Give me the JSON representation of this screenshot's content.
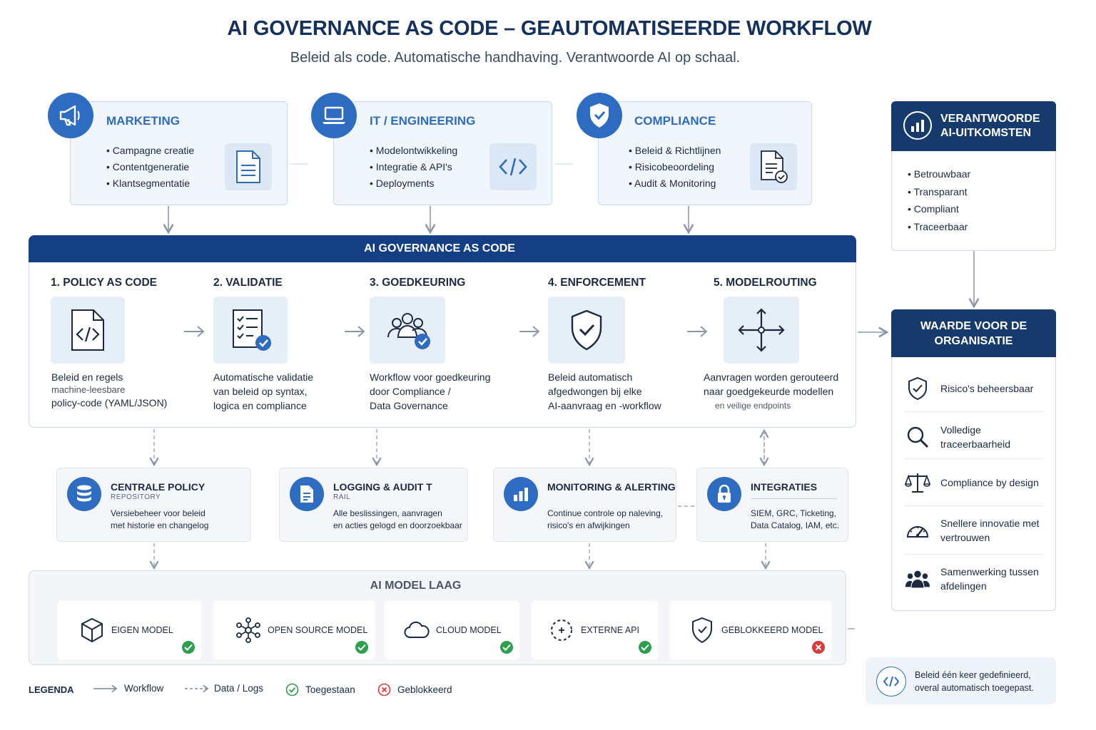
{
  "header": {
    "title": "AI GOVERNANCE AS CODE – GEAUTOMATISEERDE WORKFLOW",
    "subtitle": "Beleid als code. Automatische handhaving. Verantwoorde AI op schaal."
  },
  "departments": [
    {
      "title": "MARKETING",
      "icon": "megaphone-icon",
      "doc_icon": "document-icon",
      "items": [
        "Campagne creatie",
        "Contentgeneratie",
        "Klantsegmentatie"
      ]
    },
    {
      "title": "IT / ENGINEERING",
      "icon": "laptop-icon",
      "doc_icon": "code-icon",
      "items": [
        "Modelontwikkeling",
        "Integratie & API's",
        "Deployments"
      ]
    },
    {
      "title": "COMPLIANCE",
      "icon": "shield-check-icon",
      "doc_icon": "document-check-icon",
      "items": [
        "Beleid & Richtlijnen",
        "Risicobeoordeling",
        "Audit & Monitoring"
      ]
    }
  ],
  "governance": {
    "title": "AI GOVERNANCE AS CODE",
    "steps": [
      {
        "title": "1. POLICY AS CODE",
        "icon": "code-file-icon",
        "lines": [
          "Beleid en regels",
          "machine-leesbare",
          "policy-code (YAML/JSON)"
        ]
      },
      {
        "title": "2. VALIDATIE",
        "icon": "checklist-icon",
        "lines": [
          "Automatische validatie",
          "van beleid op syntax,",
          "logica en compliance"
        ]
      },
      {
        "title": "3. GOEDKEURING",
        "icon": "team-approval-icon",
        "lines": [
          "Workflow voor goedkeuring",
          "door Compliance /",
          "Data Governance"
        ]
      },
      {
        "title": "4. ENFORCEMENT",
        "icon": "shield-enforce-icon",
        "lines": [
          "Beleid automatisch",
          "afgedwongen bij elke",
          "AI-aanvraag en -workflow"
        ]
      },
      {
        "title": "5. MODELROUTING",
        "icon": "routing-icon",
        "lines": [
          "Aanvragen worden gerouteerd",
          "naar goedgekeurde modellen",
          "en veilige endpoints"
        ]
      }
    ]
  },
  "services": [
    {
      "title": "CENTRALE POLICY",
      "subtitle": "REPOSITORY",
      "icon": "database-icon",
      "lines": [
        "Versiebeheer voor beleid",
        "met historie en changelog"
      ]
    },
    {
      "title": "LOGGING & AUDIT T",
      "subtitle": "RAIL",
      "icon": "log-file-icon",
      "lines": [
        "Alle beslissingen, aanvragen",
        "en acties gelogd en doorzoekbaar"
      ]
    },
    {
      "title": "MONITORING & ALERTING",
      "subtitle": "",
      "icon": "bar-chart-icon",
      "lines": [
        "Continue controle op naleving,",
        "risico's en afwijkingen"
      ]
    },
    {
      "title": "INTEGRATIES",
      "subtitle": "",
      "icon": "lock-icon",
      "lines": [
        "SIEM, GRC, Ticketing,",
        "Data Catalog, IAM, etc."
      ]
    }
  ],
  "model_layer": {
    "title": "AI MODEL LAAG",
    "models": [
      {
        "label": "EIGEN MODEL",
        "icon": "cube-icon",
        "status": "allowed",
        "status_icon": "check-circle-icon"
      },
      {
        "label": "OPEN SOURCE MODEL",
        "icon": "network-icon",
        "status": "allowed",
        "status_icon": "check-circle-icon"
      },
      {
        "label": "CLOUD MODEL",
        "icon": "cloud-icon",
        "status": "allowed",
        "status_icon": "check-circle-icon"
      },
      {
        "label": "EXTERNE API",
        "icon": "dashed-circle-icon",
        "status": "allowed",
        "status_icon": "check-circle-icon"
      },
      {
        "label": "GEBLOKKEERD MODEL",
        "icon": "shield-blocked-icon",
        "status": "blocked",
        "status_icon": "x-circle-icon"
      }
    ]
  },
  "legend": {
    "title": "LEGENDA",
    "items": [
      {
        "label": "Workflow",
        "icon": "solid-arrow-icon"
      },
      {
        "label": "Data / Logs",
        "icon": "dashed-arrow-icon"
      },
      {
        "label": "Toegestaan",
        "icon": "check-circle-icon"
      },
      {
        "label": "Geblokkeerd",
        "icon": "x-circle-icon"
      }
    ]
  },
  "outcomes": {
    "title": "VERANTWOORDE AI-UITKOMSTEN",
    "icon": "bar-chart-icon",
    "items": [
      "Betrouwbaar",
      "Transparant",
      "Compliant",
      "Traceerbaar"
    ]
  },
  "value": {
    "title": "WAARDE VOOR DE ORGANISATIE",
    "items": [
      {
        "label": "Risico's beheersbaar",
        "icon": "shield-check-icon"
      },
      {
        "label": "Volledige traceerbaarheid",
        "icon": "magnifier-icon"
      },
      {
        "label": "Compliance by design",
        "icon": "scales-icon"
      },
      {
        "label": "Snellere innovatie met vertrouwen",
        "icon": "gauge-icon"
      },
      {
        "label": "Samenwerking tussen afdelingen",
        "icon": "people-icon"
      }
    ]
  },
  "note": {
    "icon": "code-icon",
    "text": "Beleid één keer gedefinieerd, overal automatisch toegepast."
  },
  "colors": {
    "primary_blue": "#2d6cc0",
    "navy": "#143f85",
    "dark_navy": "#163a6b",
    "allowed_green": "#2e9e4f",
    "blocked_red": "#d93a3a"
  }
}
